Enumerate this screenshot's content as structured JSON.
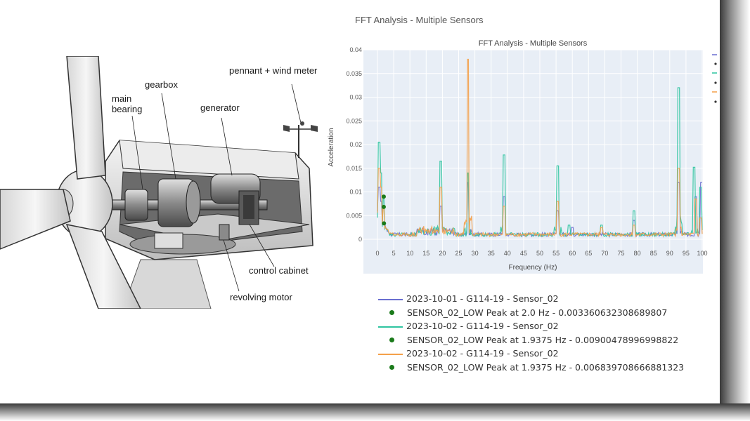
{
  "diagram": {
    "labels": {
      "gearbox": "gearbox",
      "main_bearing": "main\nbearing",
      "generator": "generator",
      "pennant": "pennant + wind meter",
      "control_cabinet": "control cabinet",
      "revolving_motor": "revolving motor"
    }
  },
  "page_title": "FFT Analysis - Multiple Sensors",
  "colors": {
    "series1": "#6a6fd0",
    "series2": "#2ec4a0",
    "series3": "#f4a04a",
    "peak": "#1a7a1a",
    "plot_bg": "#e8eef6"
  },
  "chart_data": {
    "type": "line",
    "title": "FFT Analysis - Multiple Sensors",
    "xlabel": "Frequency (Hz)",
    "ylabel": "Acceleration",
    "xlim": [
      0,
      100
    ],
    "ylim": [
      0,
      0.04
    ],
    "x_ticks": [
      "0",
      "5",
      "10",
      "15",
      "20",
      "25",
      "30",
      "35",
      "40",
      "45",
      "50",
      "55",
      "60",
      "65",
      "70",
      "75",
      "80",
      "85",
      "90",
      "95",
      "100"
    ],
    "y_ticks": [
      "0",
      "0.005",
      "0.01",
      "0.015",
      "0.02",
      "0.025",
      "0.03",
      "0.035",
      "0.04"
    ],
    "grid": true,
    "series": [
      {
        "name": "2023-10-01 - G114-19 - Sensor_02",
        "color": "#6a6fd0",
        "peaks": [
          [
            0.5,
            0.011
          ],
          [
            1.0,
            0.008
          ],
          [
            2.0,
            0.0034
          ],
          [
            19.5,
            0.007
          ],
          [
            27.8,
            0.012
          ],
          [
            39.0,
            0.009
          ],
          [
            55.5,
            0.006
          ],
          [
            60,
            0.0025
          ],
          [
            79,
            0.004
          ],
          [
            92.8,
            0.012
          ],
          [
            98,
            0.009
          ],
          [
            99.8,
            0.012
          ]
        ]
      },
      {
        "name": "2023-10-02 - G114-19 - Sensor_02",
        "color": "#2ec4a0",
        "peaks": [
          [
            0.5,
            0.0205
          ],
          [
            1.0,
            0.014
          ],
          [
            1.94,
            0.009
          ],
          [
            19.5,
            0.0165
          ],
          [
            27.8,
            0.014
          ],
          [
            39.0,
            0.0178
          ],
          [
            55.5,
            0.0155
          ],
          [
            59,
            0.003
          ],
          [
            69,
            0.003
          ],
          [
            79,
            0.006
          ],
          [
            92.8,
            0.032
          ],
          [
            97.5,
            0.0152
          ],
          [
            99.5,
            0.011
          ]
        ]
      },
      {
        "name": "2023-10-02 - G114-19 - Sensor_02",
        "color": "#f4a04a",
        "peaks": [
          [
            0.5,
            0.015
          ],
          [
            1.0,
            0.011
          ],
          [
            1.94,
            0.0068
          ],
          [
            19.5,
            0.011
          ],
          [
            27.8,
            0.038
          ],
          [
            39.0,
            0.007
          ],
          [
            55.5,
            0.008
          ],
          [
            69,
            0.0025
          ],
          [
            79,
            0.003
          ],
          [
            92.8,
            0.015
          ],
          [
            98,
            0.0085
          ],
          [
            99.5,
            0.0045
          ]
        ]
      }
    ],
    "markers": [
      {
        "name": "SENSOR_02_LOW Peak at 2.0 Hz - 0.003360632308689807",
        "x": 2.0,
        "y": 0.003360632308689807
      },
      {
        "name": "SENSOR_02_LOW Peak at 1.9375 Hz - 0.00900478996998822",
        "x": 1.9375,
        "y": 0.00900478996998822
      },
      {
        "name": "SENSOR_02_LOW Peak at 1.9375 Hz - 0.006839708666881323",
        "x": 1.9375,
        "y": 0.006839708666881323
      }
    ]
  },
  "legend": [
    {
      "kind": "line",
      "color": "#6a6fd0",
      "text": "2023-10-01 - G114-19 - Sensor_02"
    },
    {
      "kind": "dot",
      "color": "#1a7a1a",
      "text": "SENSOR_02_LOW Peak at 2.0 Hz - 0.003360632308689807"
    },
    {
      "kind": "line",
      "color": "#2ec4a0",
      "text": "2023-10-02 - G114-19 - Sensor_02"
    },
    {
      "kind": "dot",
      "color": "#1a7a1a",
      "text": "SENSOR_02_LOW Peak at 1.9375 Hz - 0.00900478996998822"
    },
    {
      "kind": "line",
      "color": "#f4a04a",
      "text": "2023-10-02 - G114-19 - Sensor_02"
    },
    {
      "kind": "dot",
      "color": "#1a7a1a",
      "text": "SENSOR_02_LOW Peak at 1.9375 Hz - 0.006839708666881323"
    }
  ]
}
